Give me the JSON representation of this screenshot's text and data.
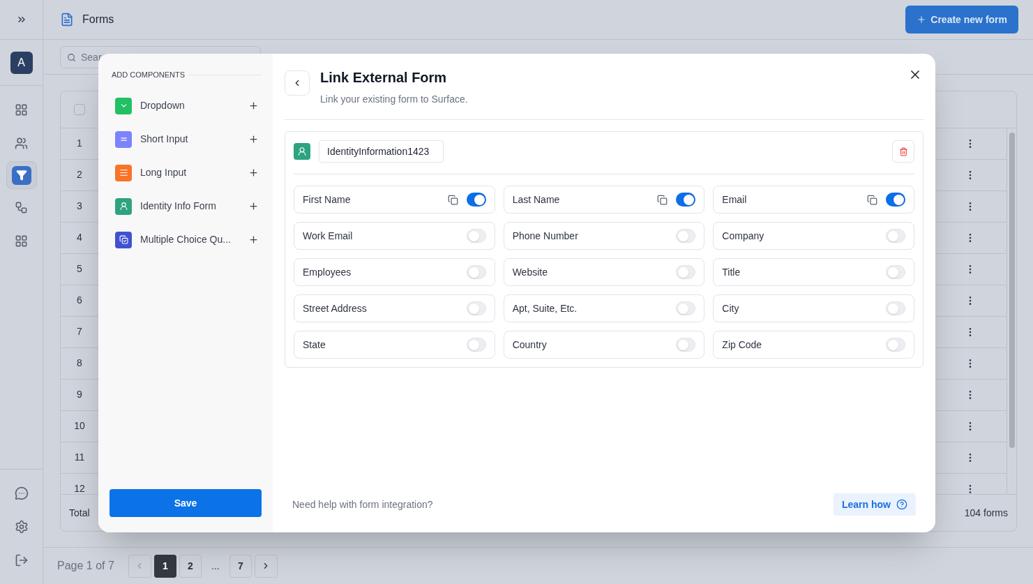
{
  "sidebar": {
    "avatar": "A",
    "nav_items": [
      {
        "kind": "grid",
        "selected": false
      },
      {
        "kind": "users",
        "selected": false
      },
      {
        "kind": "funnel",
        "selected": true
      },
      {
        "kind": "workflow",
        "selected": false
      },
      {
        "kind": "apps",
        "selected": false
      }
    ],
    "bottom_items": [
      {
        "kind": "chat"
      },
      {
        "kind": "settings"
      },
      {
        "kind": "logout"
      }
    ]
  },
  "header": {
    "title": "Forms",
    "create_button": "Create new form"
  },
  "search": {
    "placeholder": "Sear"
  },
  "table": {
    "select_all_checked": false,
    "rows": [
      {
        "number": "1"
      },
      {
        "number": "2"
      },
      {
        "number": "3"
      },
      {
        "number": "4"
      },
      {
        "number": "5"
      },
      {
        "number": "6"
      },
      {
        "number": "7"
      },
      {
        "number": "8"
      },
      {
        "number": "9"
      },
      {
        "number": "10"
      },
      {
        "number": "11"
      },
      {
        "number": "12"
      }
    ],
    "footer": {
      "label": "Total",
      "count": "104 forms"
    }
  },
  "pagination": {
    "label": "Page 1 of 7",
    "pages": [
      {
        "kind": "page",
        "label": "1",
        "selected": true
      },
      {
        "kind": "page",
        "label": "2",
        "selected": false
      },
      {
        "kind": "ellipsis",
        "label": "..."
      },
      {
        "kind": "page",
        "label": "7",
        "selected": false
      }
    ]
  },
  "modal": {
    "components_heading": "ADD COMPONENTS",
    "components": [
      {
        "kind": "dropdown",
        "label": "Dropdown",
        "color": "#22c063"
      },
      {
        "kind": "short_input",
        "label": "Short Input",
        "color": "#7b84fb"
      },
      {
        "kind": "long_input",
        "label": "Long Input",
        "color": "#f97328"
      },
      {
        "kind": "identity",
        "label": "Identity Info Form",
        "color": "#2ea37f"
      },
      {
        "kind": "multiple_choice",
        "label": "Multiple Choice Qu...",
        "color": "#4152d0"
      }
    ],
    "save_button": "Save",
    "title": "Link External Form",
    "subtitle": "Link your existing form to Surface.",
    "form_name": "IdentityInformation1423",
    "fields": [
      {
        "label": "First Name",
        "on": true
      },
      {
        "label": "Last Name",
        "on": true
      },
      {
        "label": "Email",
        "on": true
      },
      {
        "label": "Work Email",
        "on": false
      },
      {
        "label": "Phone Number",
        "on": false
      },
      {
        "label": "Company",
        "on": false
      },
      {
        "label": "Employees",
        "on": false
      },
      {
        "label": "Website",
        "on": false
      },
      {
        "label": "Title",
        "on": false
      },
      {
        "label": "Street Address",
        "on": false
      },
      {
        "label": "Apt, Suite, Etc.",
        "on": false
      },
      {
        "label": "City",
        "on": false
      },
      {
        "label": "State",
        "on": false
      },
      {
        "label": "Country",
        "on": false
      },
      {
        "label": "Zip Code",
        "on": false
      }
    ],
    "help_text": "Need help with form integration?",
    "learn_button": "Learn how"
  }
}
